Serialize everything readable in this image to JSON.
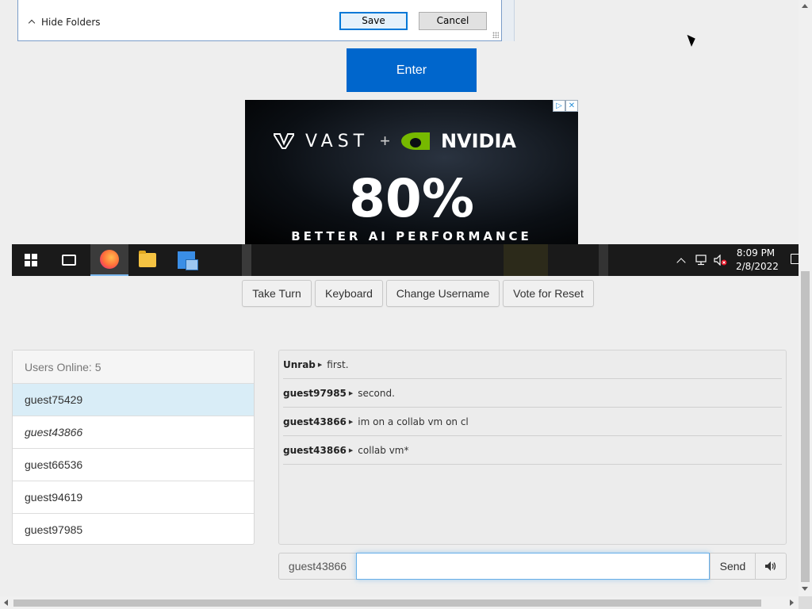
{
  "dialog": {
    "hide_folders_label": "Hide Folders",
    "save_label": "Save",
    "cancel_label": "Cancel"
  },
  "enter_button": "Enter",
  "ad": {
    "brand_left": "VAST",
    "plus": "+",
    "brand_right": "NVIDIA",
    "headline": "80%",
    "subline": "BETTER AI PERFORMANCE",
    "badge_play": "▷",
    "badge_close": "✕"
  },
  "taskbar": {
    "time": "8:09 PM",
    "date": "2/8/2022",
    "apps": [
      "start",
      "task-view",
      "firefox",
      "file-explorer",
      "network-app"
    ]
  },
  "toolbar": {
    "take_turn": "Take Turn",
    "keyboard": "Keyboard",
    "change_username": "Change Username",
    "vote_reset": "Vote for Reset"
  },
  "users": {
    "header": "Users Online: 5",
    "list": [
      "guest75429",
      "guest43866",
      "guest66536",
      "guest94619",
      "guest97985"
    ]
  },
  "chat": {
    "messages": [
      {
        "user": "Unrab",
        "text": "first."
      },
      {
        "user": "guest97985",
        "text": "second."
      },
      {
        "user": "guest43866",
        "text": "im on a collab vm on cl"
      },
      {
        "user": "guest43866",
        "text": "collab vm*"
      }
    ],
    "username": "guest43866",
    "input_value": "",
    "send_label": "Send"
  },
  "colors": {
    "enter_blue": "#0066cc",
    "active_user_bg": "#d9edf7",
    "input_focus": "#66afe9"
  }
}
